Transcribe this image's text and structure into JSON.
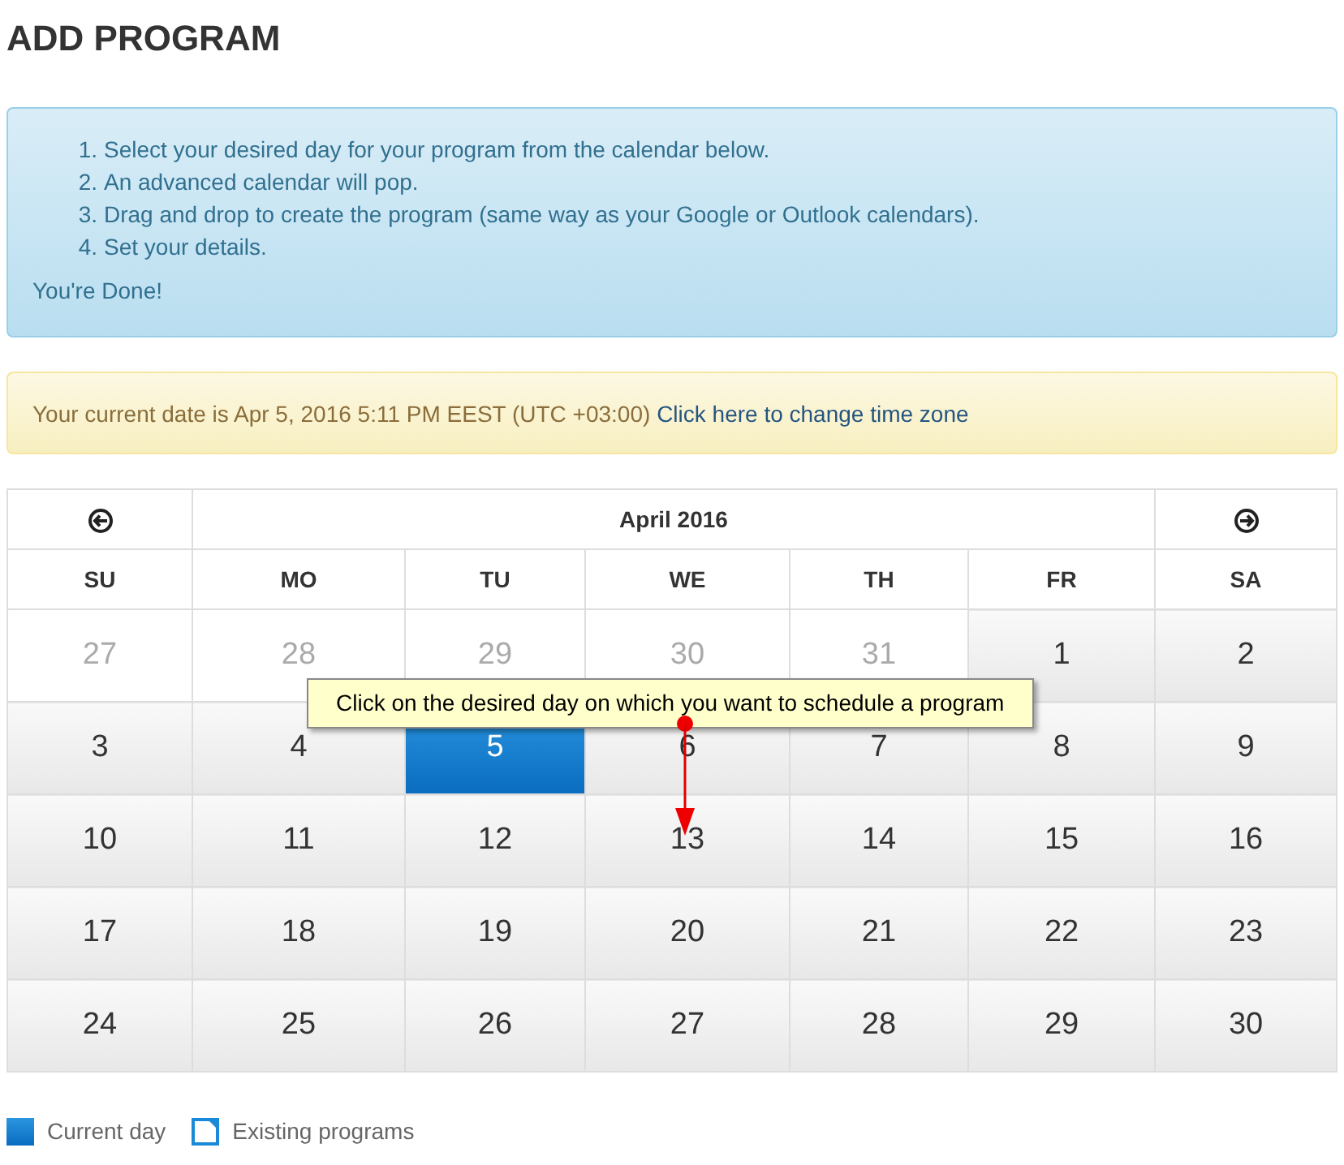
{
  "title": "ADD PROGRAM",
  "steps": [
    {
      "marker": "1.",
      "text": "Select your desired day for your program from the calendar below."
    },
    {
      "marker": "2.",
      "text": "An advanced calendar will pop."
    },
    {
      "marker": "3.",
      "text": "Drag and drop to create the program (same way as your Google or Outlook calendars)."
    },
    {
      "marker": "4.",
      "text": "Set your details."
    }
  ],
  "done_text": "You're Done!",
  "date_notice": {
    "text": "Your current date is Apr 5, 2016 5:11 PM EEST (UTC +03:00)",
    "link": "Click here to change time zone"
  },
  "calendar": {
    "month": "April 2016",
    "weekdays": [
      "SU",
      "MO",
      "TU",
      "WE",
      "TH",
      "FR",
      "SA"
    ],
    "weeks": [
      [
        {
          "label": "27",
          "kind": "other",
          "selected": false
        },
        {
          "label": "28",
          "kind": "other",
          "selected": false
        },
        {
          "label": "29",
          "kind": "other",
          "selected": false
        },
        {
          "label": "30",
          "kind": "other",
          "selected": false
        },
        {
          "label": "31",
          "kind": "other",
          "selected": false
        },
        {
          "label": "1",
          "kind": "day",
          "selected": false
        },
        {
          "label": "2",
          "kind": "day",
          "selected": false
        }
      ],
      [
        {
          "label": "3",
          "kind": "day",
          "selected": false
        },
        {
          "label": "4",
          "kind": "day",
          "selected": false
        },
        {
          "label": "5",
          "kind": "day",
          "selected": true
        },
        {
          "label": "6",
          "kind": "day",
          "selected": false
        },
        {
          "label": "7",
          "kind": "day",
          "selected": false
        },
        {
          "label": "8",
          "kind": "day",
          "selected": false
        },
        {
          "label": "9",
          "kind": "day",
          "selected": false
        }
      ],
      [
        {
          "label": "10",
          "kind": "day",
          "selected": false
        },
        {
          "label": "11",
          "kind": "day",
          "selected": false
        },
        {
          "label": "12",
          "kind": "day",
          "selected": false
        },
        {
          "label": "13",
          "kind": "day",
          "selected": false
        },
        {
          "label": "14",
          "kind": "day",
          "selected": false
        },
        {
          "label": "15",
          "kind": "day",
          "selected": false
        },
        {
          "label": "16",
          "kind": "day",
          "selected": false
        }
      ],
      [
        {
          "label": "17",
          "kind": "day",
          "selected": false
        },
        {
          "label": "18",
          "kind": "day",
          "selected": false
        },
        {
          "label": "19",
          "kind": "day",
          "selected": false
        },
        {
          "label": "20",
          "kind": "day",
          "selected": false
        },
        {
          "label": "21",
          "kind": "day",
          "selected": false
        },
        {
          "label": "22",
          "kind": "day",
          "selected": false
        },
        {
          "label": "23",
          "kind": "day",
          "selected": false
        }
      ],
      [
        {
          "label": "24",
          "kind": "day",
          "selected": false
        },
        {
          "label": "25",
          "kind": "day",
          "selected": false
        },
        {
          "label": "26",
          "kind": "day",
          "selected": false
        },
        {
          "label": "27",
          "kind": "day",
          "selected": false
        },
        {
          "label": "28",
          "kind": "day",
          "selected": false
        },
        {
          "label": "29",
          "kind": "day",
          "selected": false
        },
        {
          "label": "30",
          "kind": "day",
          "selected": false
        }
      ]
    ],
    "tooltip": "Click on the desired day on which you want to schedule a program"
  },
  "legend": [
    {
      "label": "Current day",
      "kind": "current"
    },
    {
      "label": "Existing programs",
      "kind": "existing"
    }
  ]
}
